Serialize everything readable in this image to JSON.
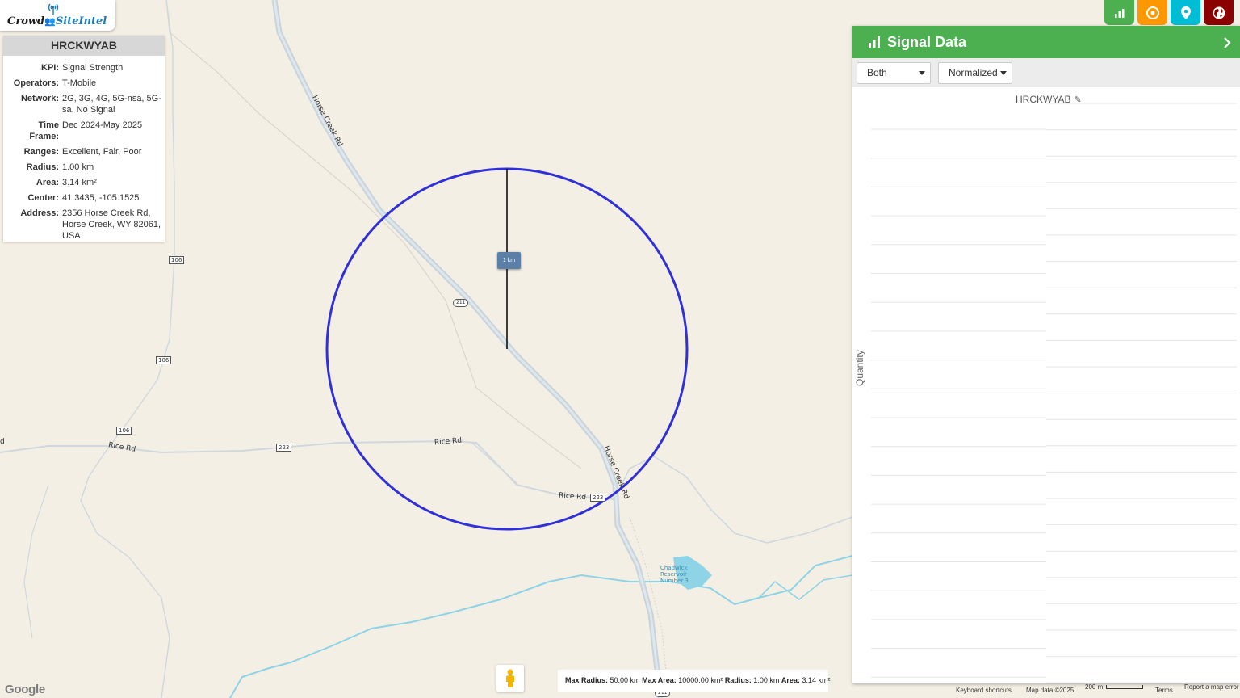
{
  "app": {
    "logo_left": "Crowd",
    "logo_right": "SiteIntel"
  },
  "info_panel": {
    "title": "HRCKWYAB",
    "rows": [
      {
        "k": "KPI:",
        "v": "Signal Strength"
      },
      {
        "k": "Operators:",
        "v": "T-Mobile"
      },
      {
        "k": "Network:",
        "v": "2G, 3G, 4G, 5G-nsa, 5G-sa, No Signal"
      },
      {
        "k": "Time Frame:",
        "v": "Dec 2024-May 2025"
      },
      {
        "k": "Ranges:",
        "v": "Excellent, Fair, Poor"
      },
      {
        "k": "Radius:",
        "v": "1.00 km"
      },
      {
        "k": "Area:",
        "v": "3.14 km²"
      },
      {
        "k": "Center:",
        "v": "41.3435, -105.1525"
      },
      {
        "k": "Address:",
        "v": "2356 Horse Creek Rd, Horse Creek, WY 82061, USA"
      }
    ]
  },
  "top_buttons": [
    {
      "name": "signal-chart-button",
      "icon": "bar-chart-icon",
      "color": "#4caf50"
    },
    {
      "name": "radius-button",
      "icon": "target-icon",
      "color": "#ff9800"
    },
    {
      "name": "location-button",
      "icon": "map-pin-icon",
      "color": "#00bcd4"
    },
    {
      "name": "globe-button",
      "icon": "globe-icon",
      "color": "#8b0000"
    }
  ],
  "map": {
    "scale_handle_label": "1 km",
    "labels": {
      "horse_creek_rd_north": "Horse Creek Rd",
      "horse_creek_rd_south": "Horse Creek Rd",
      "rice_rd_left": "Rice Rd",
      "rice_rd_center": "Rice Rd",
      "rice_rd_right": "Rice Rd",
      "edge_fragment": "d",
      "reservoir": "Chadwick Reservoir Number 3"
    },
    "shields": {
      "s106a": "106",
      "s106b": "106",
      "s106c": "106",
      "s223a": "223",
      "s223b": "223",
      "s211a": "211",
      "s211b": "211"
    },
    "circle_color": "#3030d8"
  },
  "limits": {
    "max_radius_label": "Max Radius:",
    "max_radius": "50.00 km",
    "max_area_label": "Max Area:",
    "max_area": "10000.00 km²",
    "radius_label": "Radius:",
    "radius": "1.00 km",
    "area_label": "Area:",
    "area": "3.14 km²"
  },
  "google_logo": "Google",
  "attribution": {
    "keyboard": "Keyboard shortcuts",
    "map_data": "Map data ©2025",
    "scale": "200 m",
    "terms": "Terms",
    "report": "Report a map error"
  },
  "signal_panel": {
    "title": "Signal Data",
    "accent": "#4caf50",
    "select_network": "Both",
    "select_mode": "Normalized",
    "chart_title": "HRCKWYAB",
    "y_label": "Quantity"
  }
}
